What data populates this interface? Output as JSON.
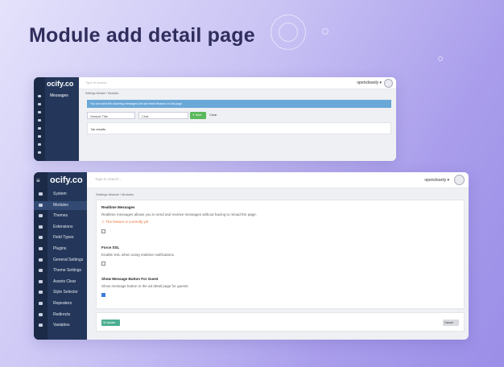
{
  "headline": "Module add detail page",
  "top_window": {
    "logo": "ocify.co",
    "menu_label": "Messages",
    "search_placeholder": "Type to search...",
    "user": "opencleanly ▾",
    "breadcrumb": "Settings Module  /  Modules",
    "alert": "You can send the incoming messages and see three Beacon on this page",
    "title_input": "Sample Title",
    "chat_input": "Chat",
    "send_label": "✈ Sent",
    "clear_label": "Clear",
    "results": "No results"
  },
  "bottom_window": {
    "logo": "ocify.co",
    "search_placeholder": "Type to search...",
    "user": "opencleanly ▾",
    "breadcrumb": "Settings Module  /  Modules",
    "sidebar": [
      {
        "label": "System",
        "icon": "home-icon"
      },
      {
        "label": "Modules",
        "icon": "gear-icon",
        "active": true
      },
      {
        "label": "Themes",
        "icon": "brush-icon"
      },
      {
        "label": "Extensions",
        "icon": "puzzle-icon"
      },
      {
        "label": "Field Types",
        "icon": "field-icon"
      },
      {
        "label": "Plugins",
        "icon": "plug-icon"
      },
      {
        "label": "General Settings",
        "icon": "sliders-icon"
      },
      {
        "label": "Theme Settings",
        "icon": "palette-icon"
      },
      {
        "label": "Assets Clear",
        "icon": "trash-icon"
      },
      {
        "label": "Style Selector",
        "icon": "style-icon"
      },
      {
        "label": "Repeaters",
        "icon": "repeat-icon"
      },
      {
        "label": "Redirects",
        "icon": "redirect-icon"
      },
      {
        "label": "Variables",
        "icon": "variable-icon"
      }
    ],
    "sections": [
      {
        "title": "Realtime Messages",
        "description": "Realtime messages allows you to send and receive messages without having to reload the page.",
        "warning": "⚠ The feature is currently yet",
        "checked": false
      },
      {
        "title": "Force SSL",
        "description": "Enable SSL when using realtime notifications.",
        "warning": "",
        "checked": false
      },
      {
        "title": "Show Message Button For Guest",
        "description": "Show message button in the ad detail page for guests.",
        "warning": "",
        "checked": true
      }
    ],
    "update_label": "🖫 Update",
    "cancel_label": "Cancel"
  }
}
